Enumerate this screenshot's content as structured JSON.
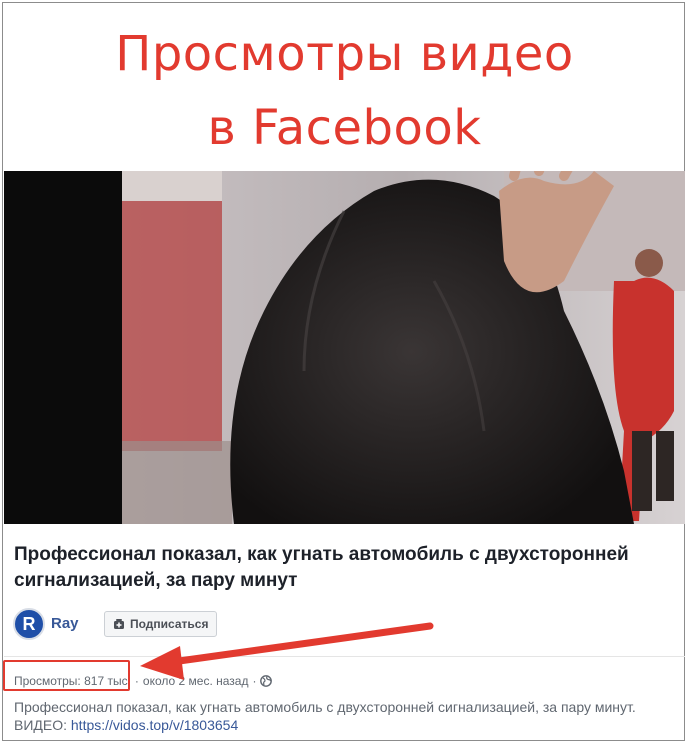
{
  "headline": {
    "line1": "Просмотры видео",
    "line2": "в Facebook"
  },
  "post": {
    "title": "Профессионал показал, как угнать автомобиль с двухсторонней сигнализацией, за пару минут",
    "author": "Ray",
    "avatar_letter": "R",
    "subscribe_label": "Подписаться",
    "views": "Просмотры: 817 тыс.",
    "separator": "·",
    "time": "около 2 мес. назад",
    "separator2": "·",
    "description": "Профессионал показал, как угнать автомобиль с двухсторонней сигнализацией, за пару минут.",
    "video_prefix": "ВИДЕО:",
    "video_link": "https://vidos.top/v/1803654"
  },
  "colors": {
    "accent_red": "#e23a2f",
    "link_blue": "#385898",
    "text_dark": "#1d2129"
  },
  "icons": [
    "subscribe-icon",
    "globe-icon",
    "annotation-arrow-icon"
  ]
}
